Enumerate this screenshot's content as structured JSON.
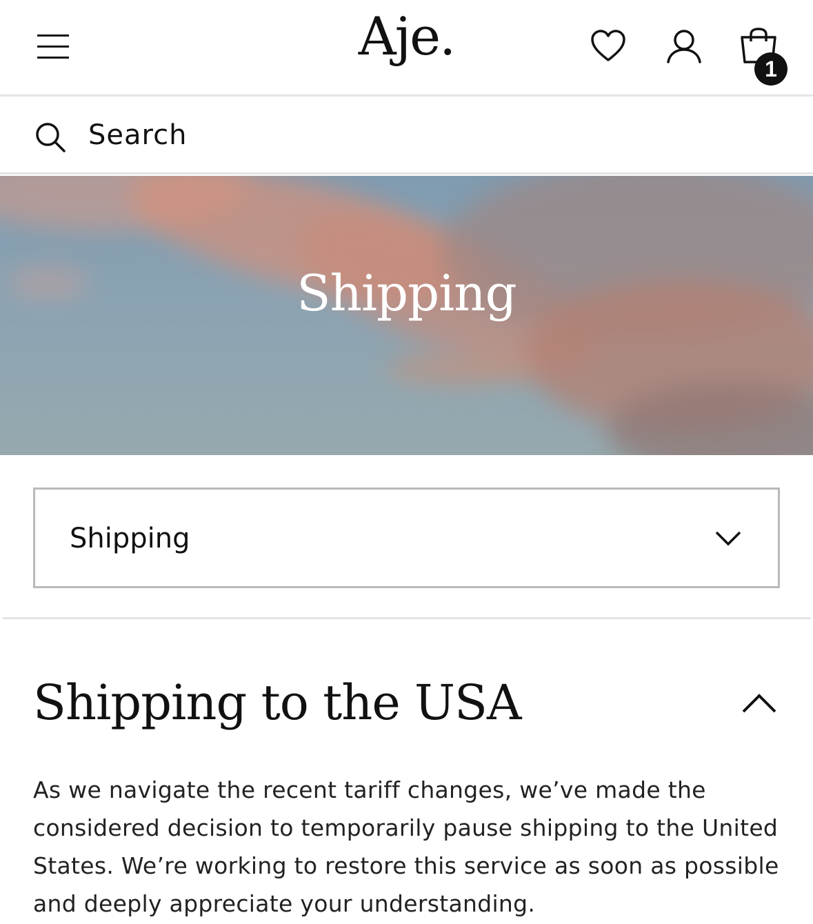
{
  "header": {
    "brand": "Aje.",
    "menu_icon": "hamburger-menu-icon",
    "wishlist_icon": "heart-icon",
    "account_icon": "user-icon",
    "cart_icon": "shopping-bag-icon",
    "cart_count": "1"
  },
  "search": {
    "icon": "search-icon",
    "placeholder": "Search"
  },
  "hero": {
    "title": "Shipping"
  },
  "page_select": {
    "selected": "Shipping",
    "icon": "chevron-down-icon"
  },
  "section": {
    "title": "Shipping to the USA",
    "toggle_icon": "chevron-up-icon",
    "body": "As we navigate the recent tariff changes, we’ve made the considered decision to temporarily pause shipping to the United States. We’re working to restore this service as soon as possible and deeply appreciate your understanding."
  }
}
